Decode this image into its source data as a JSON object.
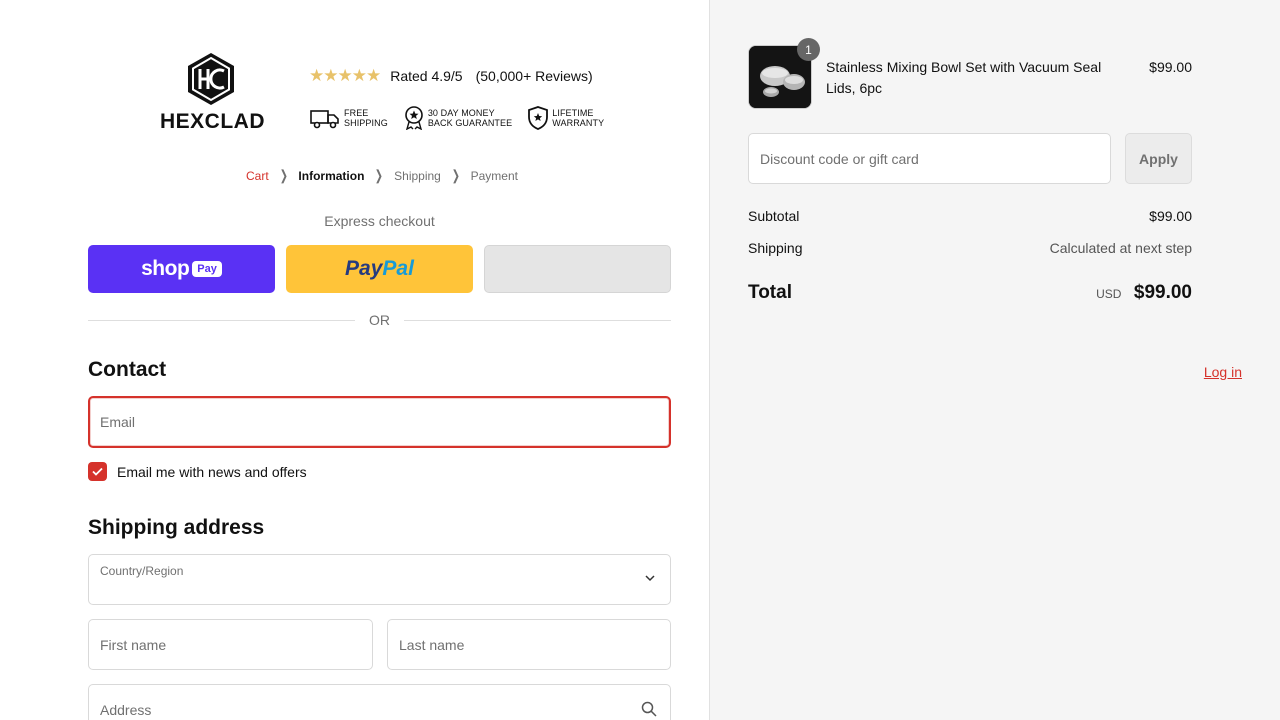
{
  "brand": {
    "name": "HEXCLAD"
  },
  "rating": {
    "stars": "★★★★★",
    "text": "Rated 4.9/5",
    "reviews": "(50,000+ Reviews)"
  },
  "badges": [
    {
      "icon": "truck-icon",
      "line1": "FREE",
      "line2": "SHIPPING"
    },
    {
      "icon": "award-icon",
      "line1": "30 DAY MONEY",
      "line2": "BACK GUARANTEE"
    },
    {
      "icon": "shield-icon",
      "line1": "LIFETIME",
      "line2": "WARRANTY"
    }
  ],
  "breadcrumb": {
    "cart": "Cart",
    "information": "Information",
    "shipping": "Shipping",
    "payment": "Payment"
  },
  "express": {
    "label": "Express checkout",
    "shop_word": "shop",
    "shop_pay": "Pay",
    "paypal_a": "Pay",
    "paypal_b": "Pal"
  },
  "divider": {
    "or": "OR"
  },
  "contact": {
    "heading": "Contact",
    "login": "Log in",
    "email_placeholder": "Email",
    "newsletter_label": "Email me with news and offers",
    "newsletter_checked": true
  },
  "shipping_address": {
    "heading": "Shipping address",
    "country_label": "Country/Region",
    "first_name_placeholder": "First name",
    "last_name_placeholder": "Last name",
    "address_placeholder": "Address"
  },
  "order": {
    "item_name": "Stainless Mixing Bowl Set with Vacuum Seal Lids, 6pc",
    "item_price": "$99.00",
    "item_qty": "1",
    "discount_placeholder": "Discount code or gift card",
    "apply_label": "Apply",
    "subtotal_label": "Subtotal",
    "subtotal_value": "$99.00",
    "shipping_label": "Shipping",
    "shipping_value": "Calculated at next step",
    "total_label": "Total",
    "currency": "USD",
    "total_value": "$99.00"
  },
  "colors": {
    "accent": "#d5322b",
    "shop_pay": "#5a31f4",
    "paypal": "#ffc439",
    "panel_bg": "#f5f5f5"
  }
}
